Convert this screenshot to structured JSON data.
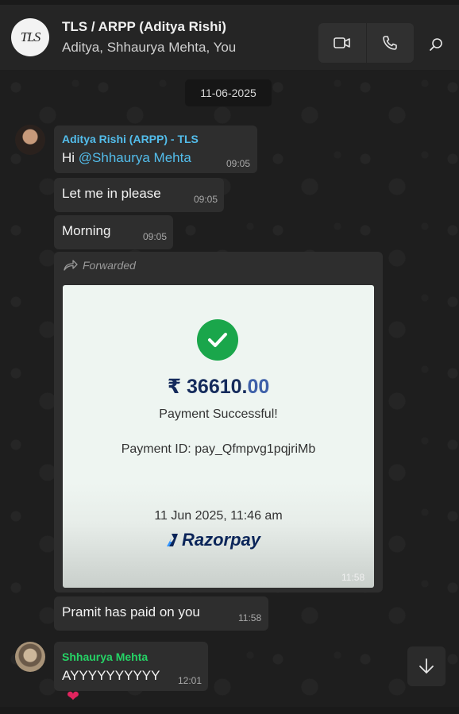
{
  "header": {
    "avatar_text": "TLS",
    "title": "TLS / ARPP (Aditya Rishi)",
    "members": "Aditya, Shhaurya Mehta, You",
    "video_icon": "video-camera-icon",
    "phone_icon": "phone-icon",
    "search_icon": "search-icon"
  },
  "date_chip": "11-06-2025",
  "messages": [
    {
      "sender": "Aditya Rishi (ARPP) - TLS",
      "sender_color": "#53bdeb",
      "prefix": "Hi ",
      "mention": "@Shhaurya Mehta",
      "time": "09:05"
    },
    {
      "text": "Let me in please",
      "time": "09:05"
    },
    {
      "text": "Morning",
      "time": "09:05"
    },
    {
      "text": "Pramit has paid on you",
      "time": "11:58"
    },
    {
      "sender": "Shhaurya Mehta",
      "sender_color": "#25d366",
      "text": "AYYYYYYYYYY",
      "time": "12:01",
      "reaction": "❤"
    }
  ],
  "forwarded": {
    "label": "Forwarded",
    "time": "11:58",
    "receipt": {
      "amount_main": "₹ 36610.",
      "amount_decimal": "00",
      "status": "Payment Successful!",
      "payment_id": "Payment ID: pay_Qfmpvg1pqjriMb",
      "datetime": "11 Jun 2025, 11:46 am",
      "brand": "Razorpay",
      "brand_color": "#0b2559",
      "check_color": "#1aa64b"
    }
  },
  "scroll_icon": "arrow-down-icon"
}
